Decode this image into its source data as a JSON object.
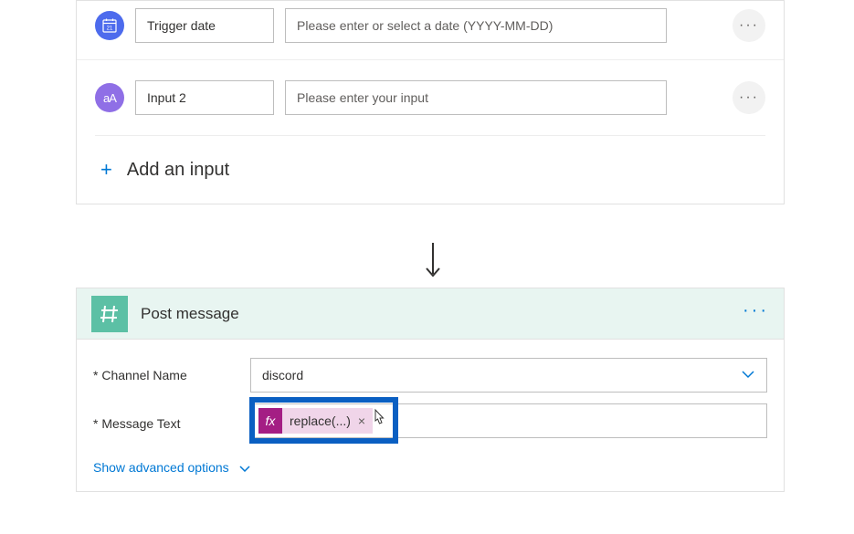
{
  "trigger": {
    "inputs": [
      {
        "icon": "calendar",
        "label": "Trigger date",
        "placeholder": "Please enter or select a date (YYYY-MM-DD)",
        "value": ""
      },
      {
        "icon": "text",
        "icon_text": "aA",
        "label": "Input 2",
        "placeholder": "Please enter your input",
        "value": ""
      }
    ],
    "add_label": "Add an input"
  },
  "action": {
    "title": "Post message",
    "fields": {
      "channel": {
        "label": "Channel Name",
        "required": "*",
        "value": "discord"
      },
      "message": {
        "label": "Message Text",
        "required": "*",
        "token_fx": "fx",
        "token_label": "replace(...)",
        "token_close": "×"
      }
    },
    "advanced_label": "Show advanced options"
  }
}
